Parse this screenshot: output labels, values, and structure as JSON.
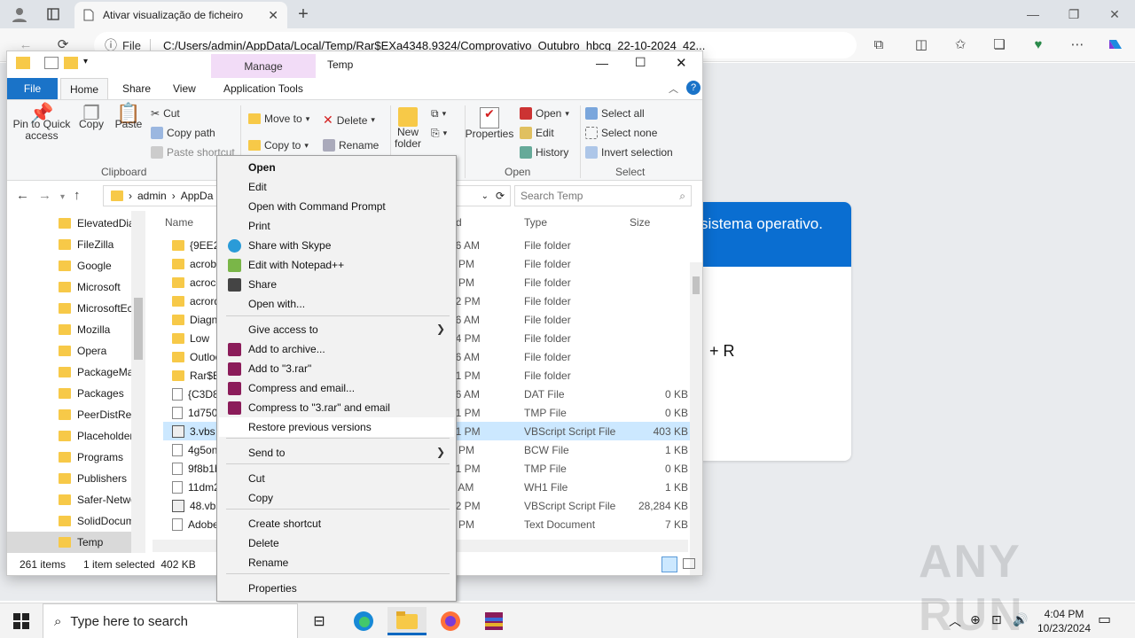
{
  "browser": {
    "tab_title": "Ativar visualização de ficheiro",
    "address_label": "File",
    "url": "C:/Users/admin/AppData/Local/Temp/Rar$EXa4348.9324/Comprovativo_Outubro_hbcq_22-10-2024_42..."
  },
  "web_content": {
    "banner_text": "sistema operativo.",
    "key_hint": "+ R"
  },
  "explorer": {
    "title": "Temp",
    "manage_tab": "Manage",
    "ribbon_tabs": [
      "File",
      "Home",
      "Share",
      "View",
      "Application Tools"
    ],
    "clipboard": {
      "pin": "Pin to Quick access",
      "copy": "Copy",
      "paste": "Paste",
      "cut": "Cut",
      "copy_path": "Copy path",
      "paste_shortcut": "Paste shortcut",
      "group": "Clipboard"
    },
    "organize": {
      "move_to": "Move to",
      "copy_to": "Copy to",
      "delete": "Delete",
      "rename": "Rename"
    },
    "new": {
      "new_folder": "New folder"
    },
    "open_group": {
      "properties": "Properties",
      "open": "Open",
      "edit": "Edit",
      "history": "History",
      "group": "Open"
    },
    "select_group": {
      "select_all": "Select all",
      "select_none": "Select none",
      "invert": "Invert selection",
      "group": "Select"
    },
    "path": {
      "seg1": "admin",
      "seg2": "AppDa"
    },
    "search_placeholder": "Search Temp",
    "nav_items": [
      "ElevatedDia",
      "FileZilla",
      "Google",
      "Microsoft",
      "MicrosoftEc",
      "Mozilla",
      "Opera",
      "PackageMa",
      "Packages",
      "PeerDistRep",
      "Placeholder",
      "Programs",
      "Publishers",
      "Safer-Netwo",
      "SolidDocum",
      "Temp"
    ],
    "columns": {
      "name": "Name",
      "date": "d",
      "type": "Type",
      "size": "Size"
    },
    "files": [
      {
        "name": "{9EE295",
        "date": "16 AM",
        "type": "File folder",
        "size": ""
      },
      {
        "name": "acrobat",
        "date": "0 PM",
        "type": "File folder",
        "size": ""
      },
      {
        "name": "acrocef",
        "date": "6 PM",
        "type": "File folder",
        "size": ""
      },
      {
        "name": "acrord3",
        "date": "42 PM",
        "type": "File folder",
        "size": ""
      },
      {
        "name": "Diagno",
        "date": "16 AM",
        "type": "File folder",
        "size": ""
      },
      {
        "name": "Low",
        "date": "44 PM",
        "type": "File folder",
        "size": ""
      },
      {
        "name": "Outloo",
        "date": "16 AM",
        "type": "File folder",
        "size": ""
      },
      {
        "name": "Rar$EX",
        "date": "01 PM",
        "type": "File folder",
        "size": ""
      },
      {
        "name": "{C3D8E",
        "date": "16 AM",
        "type": "DAT File",
        "size": "0 KB"
      },
      {
        "name": "1d7505",
        "date": "01 PM",
        "type": "TMP File",
        "size": "0 KB"
      },
      {
        "name": "3.vbs",
        "date": "01 PM",
        "type": "VBScript Script File",
        "size": "403 KB"
      },
      {
        "name": "4g5onw",
        "date": "1 PM",
        "type": "BCW File",
        "size": "1 KB"
      },
      {
        "name": "9f8b1b",
        "date": "01 PM",
        "type": "TMP File",
        "size": "0 KB"
      },
      {
        "name": "11dm2s",
        "date": "2 AM",
        "type": "WH1 File",
        "size": "1 KB"
      },
      {
        "name": "48.vbs",
        "date": "02 PM",
        "type": "VBScript Script File",
        "size": "28,284 KB"
      },
      {
        "name": "AdobeA",
        "date": "3 PM",
        "type": "Text Document",
        "size": "7 KB"
      }
    ],
    "status": {
      "count": "261 items",
      "selected": "1 item selected  402 KB"
    }
  },
  "context_menu": {
    "items": [
      {
        "label": "Open"
      },
      {
        "label": "Edit"
      },
      {
        "label": "Open with Command Prompt"
      },
      {
        "label": "Print"
      },
      {
        "label": "Share with Skype"
      },
      {
        "label": "Edit with Notepad++"
      },
      {
        "label": "Share"
      },
      {
        "label": "Open with..."
      },
      {
        "label": "Give access to"
      },
      {
        "label": "Add to archive..."
      },
      {
        "label": "Add to \"3.rar\""
      },
      {
        "label": "Compress and email..."
      },
      {
        "label": "Compress to \"3.rar\" and email"
      },
      {
        "label": "Restore previous versions"
      },
      {
        "label": "Send to"
      },
      {
        "label": "Cut"
      },
      {
        "label": "Copy"
      },
      {
        "label": "Create shortcut"
      },
      {
        "label": "Delete"
      },
      {
        "label": "Rename"
      },
      {
        "label": "Properties"
      }
    ]
  },
  "taskbar": {
    "search_placeholder": "Type here to search",
    "time": "4:04 PM",
    "date": "10/23/2024"
  },
  "watermark": "ANY RUN",
  "colors": {
    "accent": "#0067c0",
    "file_tab": "#1a73c8",
    "manage_tab": "#f2dcf7",
    "selection": "#cce8ff",
    "banner": "#0a6ed1"
  }
}
